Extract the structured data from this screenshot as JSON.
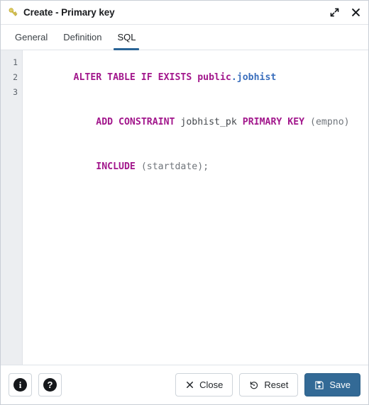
{
  "window": {
    "title": "Create - Primary key",
    "title_icon": "key-icon",
    "maximize_icon": "expand-diagonal-icon",
    "close_icon": "close-x-icon"
  },
  "tabs": [
    {
      "label": "General",
      "active": false
    },
    {
      "label": "Definition",
      "active": false
    },
    {
      "label": "SQL",
      "active": true
    }
  ],
  "editor": {
    "line_numbers": [
      "1",
      "2",
      "3"
    ],
    "lines": [
      {
        "number": "1",
        "text": "ALTER TABLE IF EXISTS public.jobhist",
        "tokens": [
          {
            "t": "ALTER TABLE IF EXISTS ",
            "c": "kw"
          },
          {
            "t": "public",
            "c": "sch"
          },
          {
            "t": ".",
            "c": "punct"
          },
          {
            "t": "jobhist",
            "c": "obj"
          }
        ]
      },
      {
        "number": "2",
        "text": "    ADD CONSTRAINT jobhist_pk PRIMARY KEY (empno)",
        "tokens": [
          {
            "t": "    ",
            "c": "plain"
          },
          {
            "t": "ADD CONSTRAINT",
            "c": "kw"
          },
          {
            "t": " ",
            "c": "plain"
          },
          {
            "t": "jobhist_pk",
            "c": "ident"
          },
          {
            "t": " ",
            "c": "plain"
          },
          {
            "t": "PRIMARY KEY",
            "c": "kw"
          },
          {
            "t": " (empno)",
            "c": "plain"
          }
        ]
      },
      {
        "number": "3",
        "text": "    INCLUDE (startdate);",
        "tokens": [
          {
            "t": "    ",
            "c": "plain"
          },
          {
            "t": "INCLUDE",
            "c": "kw"
          },
          {
            "t": " (startdate);",
            "c": "plain"
          }
        ]
      }
    ]
  },
  "footer": {
    "info_label": "i",
    "help_label": "?",
    "close_label": "Close",
    "reset_label": "Reset",
    "save_label": "Save"
  },
  "colors": {
    "accent": "#2a6496",
    "save_button": "#336a96",
    "keyword": "#a2178c",
    "object": "#3b6fbd",
    "key_icon": "#e8d24a"
  }
}
